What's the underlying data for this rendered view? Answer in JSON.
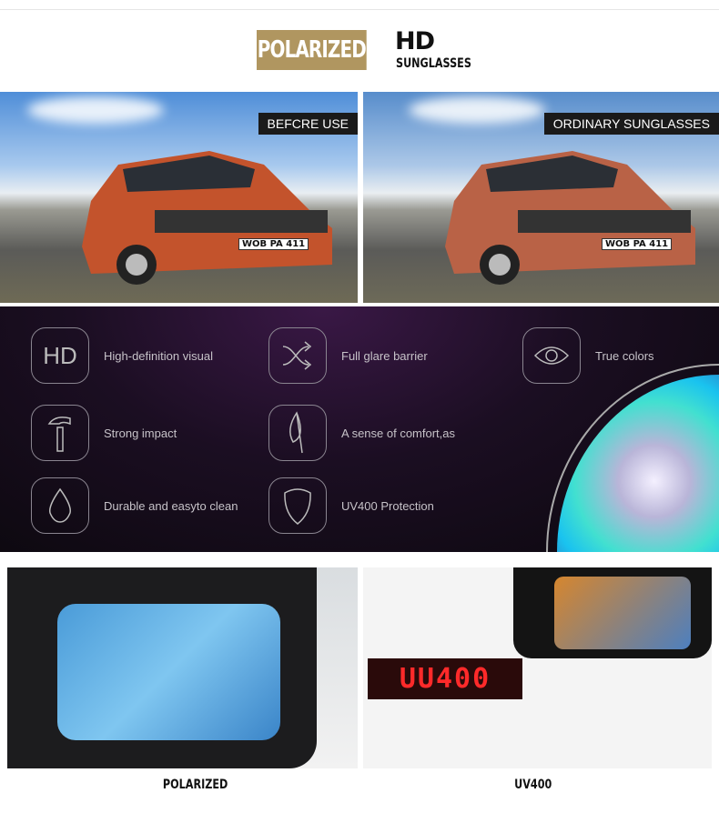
{
  "header": {
    "badge": "POLARIZED",
    "title": "HD",
    "subtitle": "SUNGLASSES",
    "badge_color": "#b09660"
  },
  "comparison": [
    {
      "tag": "BEFCRE USE",
      "plate": "WOB PA 411"
    },
    {
      "tag": "ORDINARY SUNGLASSES",
      "plate": "WOB PA 411"
    }
  ],
  "features": [
    {
      "icon": "hd-icon",
      "label": "High-definition visual"
    },
    {
      "icon": "shuffle-arrows-icon",
      "label": "Full glare barrier"
    },
    {
      "icon": "eye-icon",
      "label": "True colors"
    },
    {
      "icon": "hammer-icon",
      "label": "Strong impact"
    },
    {
      "icon": "feather-icon",
      "label": "A sense of comfort,as"
    },
    {
      "icon": "drop-icon",
      "label": "Durable and easyto clean"
    },
    {
      "icon": "shield-icon",
      "label": "UV400 Protection"
    }
  ],
  "hd_glyph": "HD",
  "bottom": [
    {
      "label": "POLARIZED"
    },
    {
      "label": "UV400",
      "meter": "UU400"
    }
  ]
}
